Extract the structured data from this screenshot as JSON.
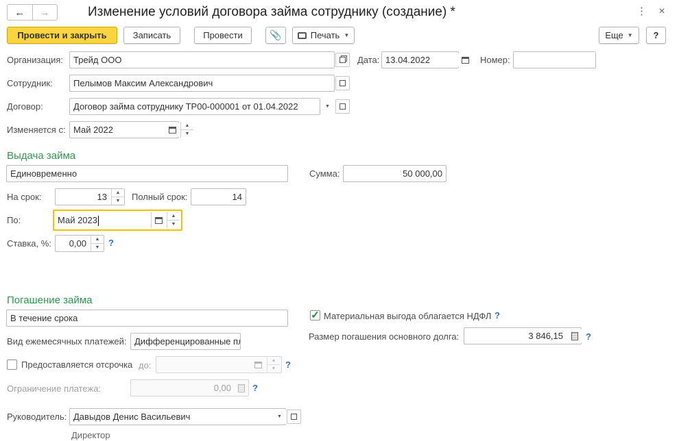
{
  "window": {
    "title": "Изменение условий договора займа сотруднику (создание) *"
  },
  "toolbar": {
    "post_close": "Провести и закрыть",
    "save": "Записать",
    "post": "Провести",
    "print": "Печать",
    "more": "Еще",
    "help": "?"
  },
  "header": {
    "org_label": "Организация:",
    "org_value": "Трейд ООО",
    "date_label": "Дата:",
    "date_value": "13.04.2022",
    "number_label": "Номер:",
    "number_value": "",
    "employee_label": "Сотрудник:",
    "employee_value": "Пелымов Максим Александрович",
    "contract_label": "Договор:",
    "contract_value": "Договор займа сотруднику ТР00-000001 от 01.04.2022",
    "changed_from_label": "Изменяется с:",
    "changed_from_value": "Май 2022"
  },
  "issue": {
    "title": "Выдача займа",
    "method_value": "Единовременно",
    "sum_label": "Сумма:",
    "sum_value": "50 000,00",
    "term_label": "На срок:",
    "term_value": "13",
    "full_term_label": "Полный срок:",
    "full_term_value": "14",
    "until_label": "По:",
    "until_value": "Май 2023",
    "rate_label": "Ставка, %:",
    "rate_value": "0,00",
    "help": "?"
  },
  "repay": {
    "title": "Погашение займа",
    "method_value": "В течение срока",
    "benefit_label": "Материальная выгода облагается НДФЛ",
    "benefit_checked": true,
    "payments_label": "Вид ежемесячных платежей:",
    "payments_value": "Дифференцированные пла",
    "principal_label": "Размер погашения основного долга:",
    "principal_value": "3 846,15",
    "deferral_label": "Предоставляется отсрочка",
    "deferral_checked": false,
    "deferral_to_label": "до:",
    "deferral_to_value": "",
    "limit_label": "Ограничение платежа:",
    "limit_value": "0,00",
    "help": "?"
  },
  "footer": {
    "head_label": "Руководитель:",
    "head_value": "Давыдов Денис Васильевич",
    "head_position": "Директор"
  },
  "colors": {
    "accent_yellow": "#fbd53f",
    "section_green": "#2a9a4a",
    "help_blue": "#2b70c9"
  }
}
